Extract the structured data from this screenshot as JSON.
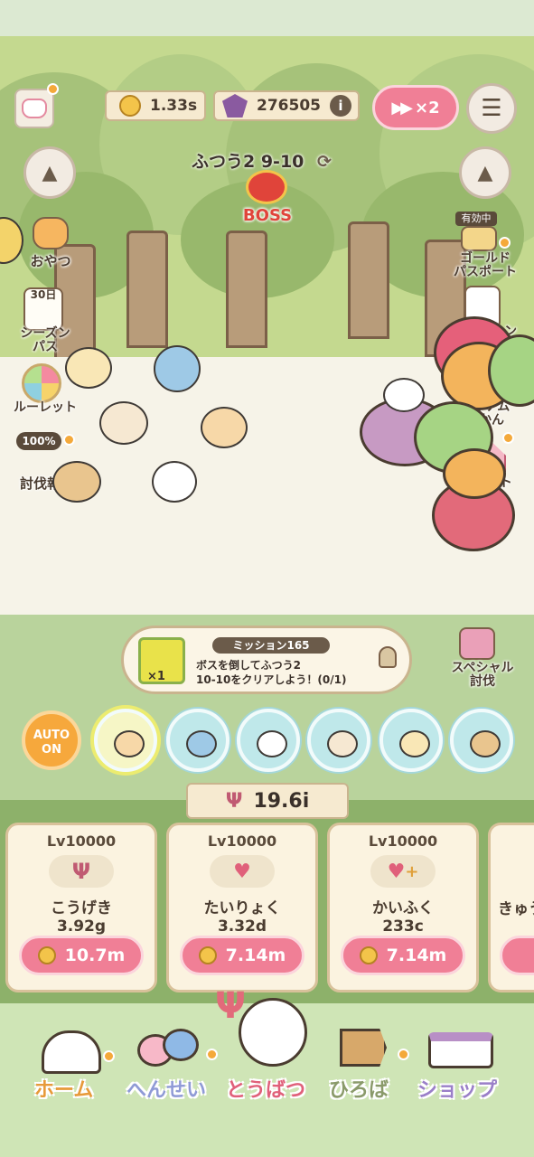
{
  "top_bar": {
    "time_value": "1.33s",
    "gem_value": "276505",
    "info_icon": "i",
    "speed_label": "×2"
  },
  "stage": {
    "title": "ふつう2 9-10",
    "boss_label": "BOSS"
  },
  "left_menu": {
    "snack": "おやつ",
    "season_days": "30日",
    "season_pass": "シーズン\nパス",
    "roulette": "ルーレット",
    "reward_percent": "100%",
    "reward": "討伐報酬"
  },
  "right_menu": {
    "active_badge": "有効中",
    "gold_passport": "ゴールド\nパスポート",
    "mission": "ミッション",
    "item_book": "アイテム\nずかん",
    "event": "イベント"
  },
  "mission": {
    "title": "ミッション165",
    "reward_count": "×1",
    "text_line1": "ボスを倒してふつう2",
    "text_line2": "10-10をクリアしよう！(0/1)",
    "special_label": "スペシャル\n討伐"
  },
  "auto_button": {
    "line1": "AUTO",
    "line2": "ON"
  },
  "power": {
    "value": "19.6i"
  },
  "cards": [
    {
      "lv": "Lv10000",
      "name": "こうげき",
      "value": "3.92g",
      "cost": "10.7m"
    },
    {
      "lv": "Lv10000",
      "name": "たいりょく",
      "value": "3.32d",
      "cost": "7.14m"
    },
    {
      "lv": "Lv10000",
      "name": "かいふく",
      "value": "233c",
      "cost": "7.14m"
    },
    {
      "lv": "",
      "name": "きゅう",
      "value": "",
      "cost": ""
    }
  ],
  "nav": {
    "home": "ホーム",
    "formation": "へんせい",
    "battle": "とうばつ",
    "plaza": "ひろば",
    "shop": "ショップ"
  },
  "colors": {
    "pink_button": "#f07f96",
    "boss_red": "#e0443a",
    "gold": "#f3c44a",
    "party_bubble": "#bfe8ea"
  }
}
